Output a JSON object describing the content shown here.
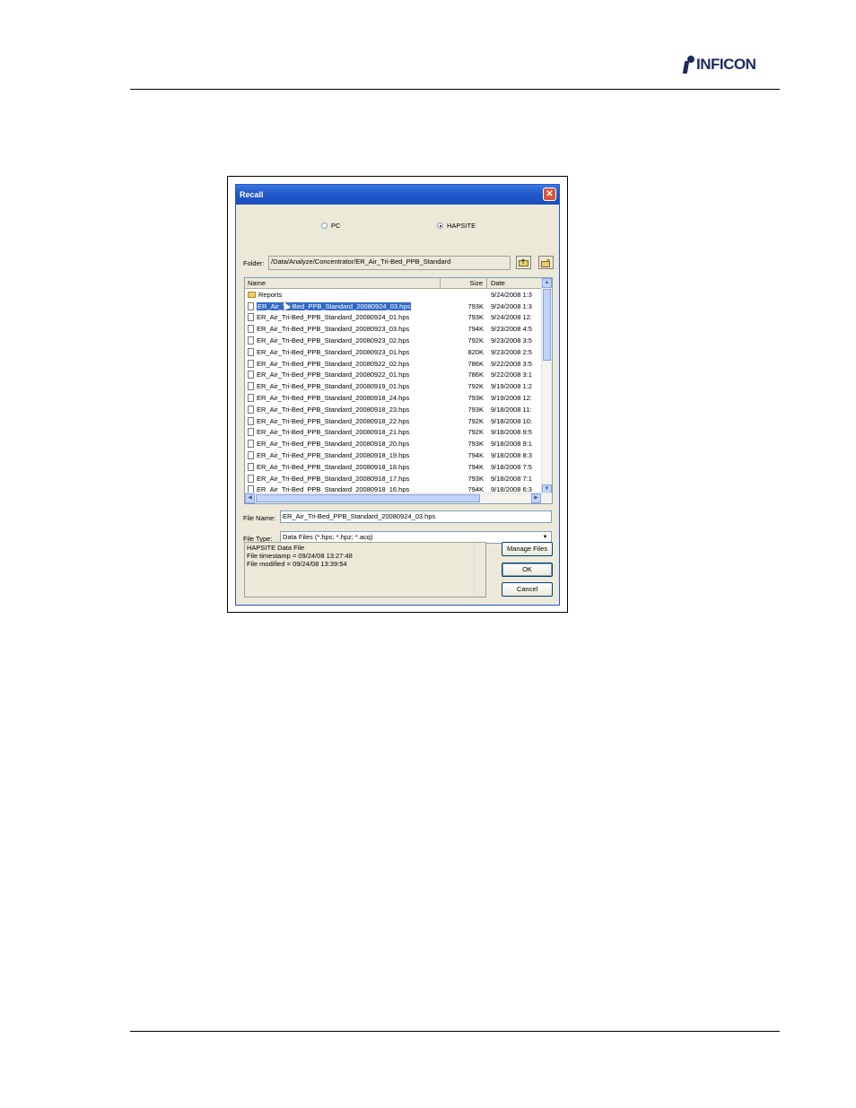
{
  "page": {
    "logo_text": "INFICON"
  },
  "dialog": {
    "title": "Recall",
    "close_glyph": "✕",
    "source_options": [
      {
        "label": "PC",
        "selected": false
      },
      {
        "label": "HAPSITE",
        "selected": true
      }
    ],
    "folder_label": "Folder:",
    "folder_path": "/Data/Analyze/Concentrator/ER_Air_Tri-Bed_PPB_Standard",
    "columns": {
      "name": "Name",
      "size": "Size",
      "date": "Date"
    },
    "files": [
      {
        "name": "Reports",
        "size": "",
        "date": "9/24/2008 1:3",
        "type": "folder",
        "selected": false
      },
      {
        "name": "ER_Air_Tri-Bed_PPB_Standard_20080924_03.hps",
        "size": "793K",
        "date": "9/24/2008 1:3",
        "type": "file",
        "selected": true
      },
      {
        "name": "ER_Air_Tri-Bed_PPB_Standard_20080924_01.hps",
        "size": "793K",
        "date": "9/24/2008 12:",
        "type": "file",
        "selected": false
      },
      {
        "name": "ER_Air_Tri-Bed_PPB_Standard_20080923_03.hps",
        "size": "794K",
        "date": "9/23/2008 4:5",
        "type": "file",
        "selected": false
      },
      {
        "name": "ER_Air_Tri-Bed_PPB_Standard_20080923_02.hps",
        "size": "792K",
        "date": "9/23/2008 3:5",
        "type": "file",
        "selected": false
      },
      {
        "name": "ER_Air_Tri-Bed_PPB_Standard_20080923_01.hps",
        "size": "820K",
        "date": "9/23/2008 2:5",
        "type": "file",
        "selected": false
      },
      {
        "name": "ER_Air_Tri-Bed_PPB_Standard_20080922_02.hps",
        "size": "786K",
        "date": "9/22/2008 3:5",
        "type": "file",
        "selected": false
      },
      {
        "name": "ER_Air_Tri-Bed_PPB_Standard_20080922_01.hps",
        "size": "786K",
        "date": "9/22/2008 3:1",
        "type": "file",
        "selected": false
      },
      {
        "name": "ER_Air_Tri-Bed_PPB_Standard_20080919_01.hps",
        "size": "792K",
        "date": "9/19/2008 1:2",
        "type": "file",
        "selected": false
      },
      {
        "name": "ER_Air_Tri-Bed_PPB_Standard_20080918_24.hps",
        "size": "793K",
        "date": "9/19/2008 12:",
        "type": "file",
        "selected": false
      },
      {
        "name": "ER_Air_Tri-Bed_PPB_Standard_20080918_23.hps",
        "size": "793K",
        "date": "9/18/2008 11:",
        "type": "file",
        "selected": false
      },
      {
        "name": "ER_Air_Tri-Bed_PPB_Standard_20080918_22.hps",
        "size": "792K",
        "date": "9/18/2008 10:",
        "type": "file",
        "selected": false
      },
      {
        "name": "ER_Air_Tri-Bed_PPB_Standard_20080918_21.hps",
        "size": "792K",
        "date": "9/18/2008 9:5",
        "type": "file",
        "selected": false
      },
      {
        "name": "ER_Air_Tri-Bed_PPB_Standard_20080918_20.hps",
        "size": "793K",
        "date": "9/18/2008 9:1",
        "type": "file",
        "selected": false
      },
      {
        "name": "ER_Air_Tri-Bed_PPB_Standard_20080918_19.hps",
        "size": "794K",
        "date": "9/18/2008 8:3",
        "type": "file",
        "selected": false
      },
      {
        "name": "ER_Air_Tri-Bed_PPB_Standard_20080918_18.hps",
        "size": "794K",
        "date": "9/18/2008 7:5",
        "type": "file",
        "selected": false
      },
      {
        "name": "ER_Air_Tri-Bed_PPB_Standard_20080918_17.hps",
        "size": "793K",
        "date": "9/18/2008 7:1",
        "type": "file",
        "selected": false
      },
      {
        "name": "ER_Air_Tri-Bed_PPB_Standard_20080918_16.hps",
        "size": "794K",
        "date": "9/18/2008 6:3",
        "type": "file",
        "selected": false
      }
    ],
    "filename_label": "File Name:",
    "filename_value": "ER_Air_Tri-Bed_PPB_Standard_20080924_03.hps",
    "filetype_label": "File Type:",
    "filetype_value": "Data Files (*.hps; *.hpz; *.acq)",
    "description_lines": [
      "HAPSITE Data File",
      "File timestamp = 09/24/08 13:27:48",
      "File modified = 09/24/08 13:39:54"
    ],
    "buttons": {
      "manage": "Manage Files",
      "ok": "OK",
      "cancel": "Cancel"
    },
    "accent_color": "#316ac5"
  }
}
